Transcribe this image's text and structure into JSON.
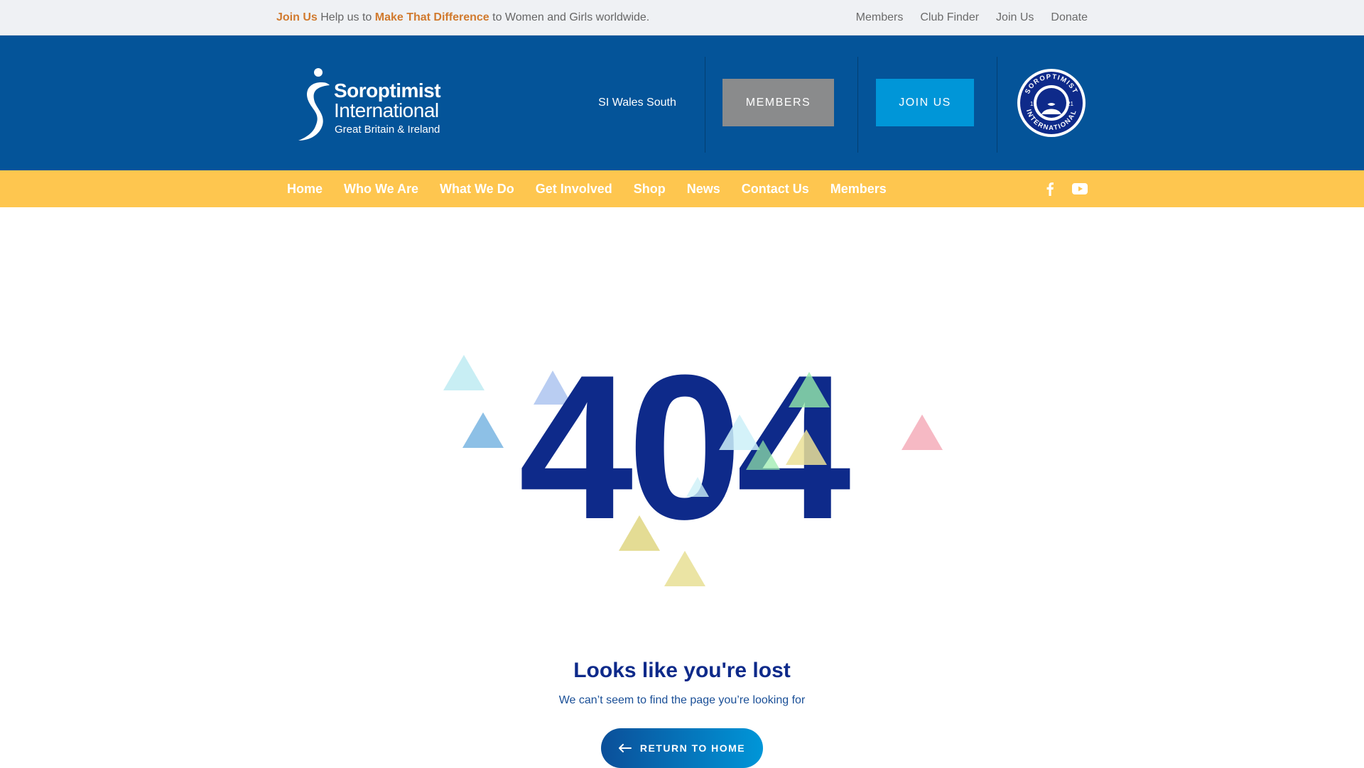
{
  "topbar": {
    "tagline": {
      "join": "Join Us",
      "part1": " Help us to ",
      "highlight": "Make That Difference",
      "part2": " to Women and Girls worldwide."
    },
    "links": [
      "Members",
      "Club Finder",
      "Join Us",
      "Donate"
    ]
  },
  "header": {
    "logo": {
      "line1": "Soroptimist",
      "line2": "International",
      "line3": "Great Britain & Ireland"
    },
    "region": "SI Wales South",
    "members_button": "MEMBERS",
    "join_button": "JOIN US",
    "badge": {
      "top_text": "SOROPTIMIST",
      "bottom_text": "INTERNATIONAL",
      "year_left": "19",
      "year_right": "21"
    }
  },
  "nav": {
    "items": [
      "Home",
      "Who We Are",
      "What We Do",
      "Get Involved",
      "Shop",
      "News",
      "Contact Us",
      "Members"
    ],
    "social": [
      "facebook-icon",
      "youtube-icon"
    ]
  },
  "error": {
    "code": "404",
    "title": "Looks like you're lost",
    "subtitle": "We can’t seem to find the page you’re looking for",
    "button": "RETURN TO HOME"
  },
  "colors": {
    "header_blue": "#045499",
    "nav_yellow": "#fec64f",
    "heading_navy": "#0e2a8a",
    "accent_orange": "#d17a2e",
    "join_blue": "#0096d8",
    "members_gray": "#8a8b8c"
  }
}
